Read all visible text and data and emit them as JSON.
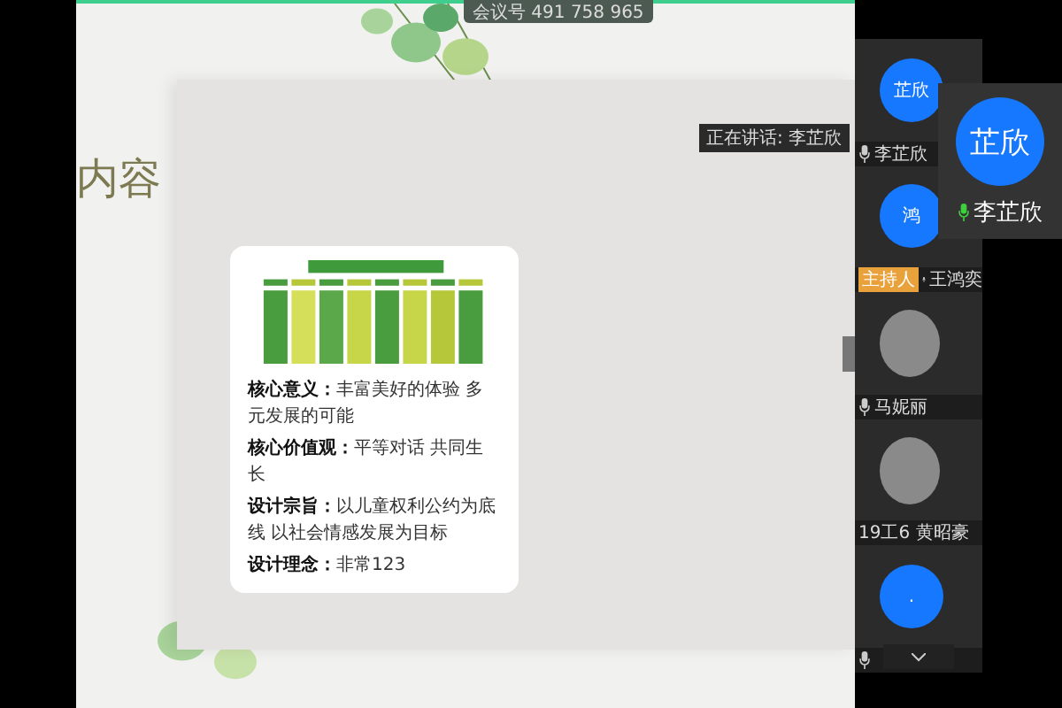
{
  "meeting": {
    "id_label": "会议号 491 758 965"
  },
  "slide": {
    "title": "内容",
    "lines": [
      {
        "label": "核心意义：",
        "text": "丰富美好的体验 多元发展的可能"
      },
      {
        "label": "核心价值观：",
        "text": "平等对话 共同生长"
      },
      {
        "label": "设计宗旨：",
        "text": "以儿童权利公约为底线 以社会情感发展为目标"
      },
      {
        "label": "设计理念：",
        "text": "非常123"
      }
    ]
  },
  "speaking_tooltip": "正在讲话: 李芷欣",
  "participants": [
    {
      "kind": "initials",
      "avatar_text": "芷欣",
      "name": "李芷欣",
      "mic": true,
      "host": false
    },
    {
      "kind": "initials",
      "avatar_text": "鸿",
      "name": "王鸿奕",
      "mic": true,
      "host": true,
      "host_label": "主持人"
    },
    {
      "kind": "photo",
      "name": "马妮丽",
      "mic": true,
      "host": false
    },
    {
      "kind": "photo",
      "name": "19工6 黄昭豪",
      "mic": false,
      "host": false
    },
    {
      "kind": "initials",
      "avatar_text": ".",
      "mic": true,
      "host": false
    }
  ],
  "floating_tile": {
    "avatar_text": "芷欣",
    "name": "李芷欣",
    "mic": true
  }
}
